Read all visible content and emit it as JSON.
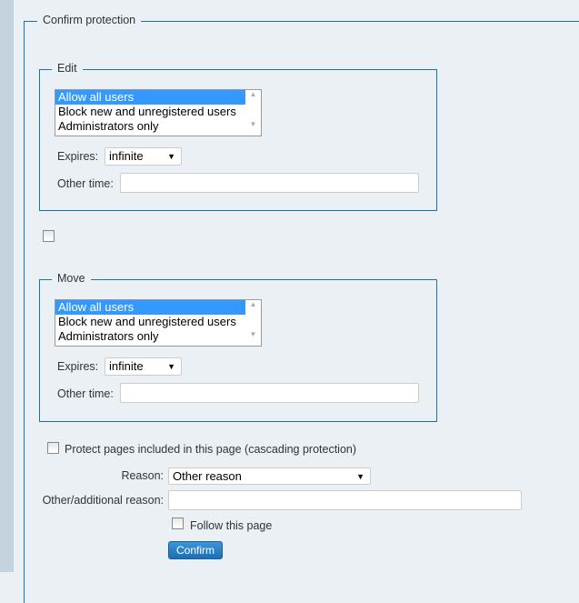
{
  "outer_legend": "Confirm protection",
  "edit": {
    "legend": "Edit",
    "options": [
      "Allow all users",
      "Block new and unregistered users",
      "Administrators only"
    ],
    "selected": 0,
    "expires_label": "Expires:",
    "expires_value": "infinite",
    "other_time_label": "Other time:",
    "other_time_value": ""
  },
  "move": {
    "legend": "Move",
    "options": [
      "Allow all users",
      "Block new and unregistered users",
      "Administrators only"
    ],
    "selected": 0,
    "expires_label": "Expires:",
    "expires_value": "infinite",
    "other_time_label": "Other time:",
    "other_time_value": ""
  },
  "cascade_label": "Protect pages included in this page (cascading protection)",
  "reason_label": "Reason:",
  "reason_value": "Other reason",
  "other_reason_label": "Other/additional reason:",
  "other_reason_value": "",
  "follow_label": "Follow this page",
  "confirm_label": "Confirm"
}
